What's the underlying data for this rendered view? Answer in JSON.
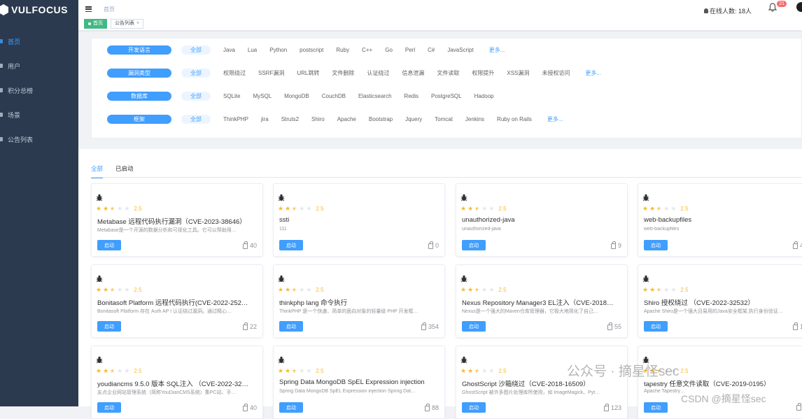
{
  "app": {
    "logo_text": "VULFOCUS"
  },
  "sidebar": {
    "items": [
      {
        "label": "首页",
        "active": true
      },
      {
        "label": "用户",
        "active": false
      },
      {
        "label": "积分总榜",
        "active": false
      },
      {
        "label": "场景",
        "active": false
      },
      {
        "label": "公告列表",
        "active": false
      }
    ]
  },
  "topbar": {
    "breadcrumb": "首页",
    "online_label": "在线人数: 18人",
    "notification_count": "21"
  },
  "tags": [
    {
      "label": "首页",
      "active": true
    },
    {
      "label": "公告列表",
      "active": false,
      "close": "×"
    }
  ],
  "filters": [
    {
      "category": "开发语言",
      "all": "全部",
      "options": [
        "Java",
        "Lua",
        "Python",
        "postscript",
        "Ruby",
        "C++",
        "Go",
        "Perl",
        "C#",
        "JavaScript"
      ],
      "more": "更多..."
    },
    {
      "category": "漏洞类型",
      "all": "全部",
      "options": [
        "权限绕过",
        "SSRF漏洞",
        "URL跳转",
        "文件删除",
        "认证绕过",
        "信息泄漏",
        "文件读取",
        "权限提升",
        "XSS漏洞",
        "未授权访问"
      ],
      "more": "更多..."
    },
    {
      "category": "数据库",
      "all": "全部",
      "options": [
        "SQLite",
        "MySQL",
        "MongoDB",
        "CouchDB",
        "Elasticsearch",
        "Redis",
        "PostgreSQL",
        "Hadoop"
      ],
      "more": ""
    },
    {
      "category": "框架",
      "all": "全部",
      "options": [
        "ThinkPHP",
        "jira",
        "Struts2",
        "Shiro",
        "Apache",
        "Bootstrap",
        "Jquery",
        "Tomcat",
        "Jenkins",
        "Ruby on Rails"
      ],
      "more": "更多..."
    }
  ],
  "tabs": [
    {
      "label": "全部",
      "active": true
    },
    {
      "label": "已启动",
      "active": false
    }
  ],
  "cards": [
    {
      "rating": 2.5,
      "score": "2.5",
      "title": "Metabase 远程代码执行漏洞（CVE-2023-38646）",
      "desc": "Metabase是一个开源的数据分析和可视化工具。它可以帮助用…",
      "button": "启动",
      "count": "40"
    },
    {
      "rating": 2.5,
      "score": "2.5",
      "title": "ssti",
      "desc": "111",
      "button": "启动",
      "count": "0"
    },
    {
      "rating": 2.5,
      "score": "2.5",
      "title": "unauthorized-java",
      "desc": "unauthorized-java",
      "button": "启动",
      "count": "9"
    },
    {
      "rating": 2.5,
      "score": "2.5",
      "title": "web-backupfiles",
      "desc": "web-backupfiles",
      "button": "启动",
      "count": "4"
    },
    {
      "rating": 2.5,
      "score": "2.5",
      "title": "Bonitasoft Platform 远程代码执行(CVE-2022-252…",
      "desc": "Bonitasoft Platform 存在 Auth AP I 认证绕过漏洞。通过精心…",
      "button": "启动",
      "count": "22"
    },
    {
      "rating": 2.5,
      "score": "2.5",
      "title": "thinkphp lang 命令执行",
      "desc": "ThinkPHP 是一个快速、简单的面向对象的轻量级 PHP 开发框…",
      "button": "启动",
      "count": "354"
    },
    {
      "rating": 2.5,
      "score": "2.5",
      "title": "Nexus Repository Manager3 EL注入（CVE-2018…",
      "desc": "Nexus是一个强大的Maven仓库管理器，它极大地简化了自己…",
      "button": "启动",
      "count": "55"
    },
    {
      "rating": 2.5,
      "score": "2.5",
      "title": "Shiro 授权绕过 （CVE-2022-32532）",
      "desc": "Apache Shiro是一个强大且易用的Java安全框架,执行身份验证…",
      "button": "启动",
      "count": "1"
    },
    {
      "rating": 2.5,
      "score": "2.5",
      "title": "youdiancms 9.5.0 版本 SQL注入 （CVE-2022-32…",
      "desc": "友点企业网站管理系统（简称YouDianCMS系统）集PC站、手…",
      "button": "启动",
      "count": "40"
    },
    {
      "rating": 2.5,
      "score": "2.5",
      "title": "Spring Data MongoDB SpEL Expression injection",
      "desc": "Spring Data MongoDB SpEL Expression injection Spring Dat…",
      "button": "启动",
      "count": "88"
    },
    {
      "rating": 2.5,
      "score": "2.5",
      "title": "GhostScript 沙箱绕过（CVE-2018-16509）",
      "desc": "GhostScript 被许多图片处理库所使用，如 ImageMagick、Pyt…",
      "button": "启动",
      "count": "123"
    },
    {
      "rating": 2.5,
      "score": "2.5",
      "title": "tapestry 任意文件读取（CVE-2019-0195）",
      "desc": "Apache Tapestry…",
      "button": "启动",
      "count": ""
    }
  ],
  "watermark": {
    "line1": "公众号 · 摘星怪sec",
    "line2": "CSDN @摘星怪sec"
  },
  "colors": {
    "sidebar_bg": "#2b3a4f",
    "accent": "#409eff",
    "tag_active": "#42b983",
    "star": "#f7ba2a"
  }
}
